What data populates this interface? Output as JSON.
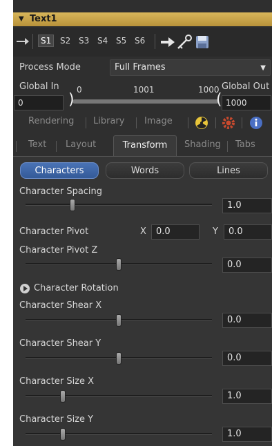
{
  "tool": {
    "name": "Text1"
  },
  "toolbar": {
    "slots": [
      "S1",
      "S2",
      "S3",
      "S4",
      "S5",
      "S6"
    ],
    "selected_slot": "S1"
  },
  "process_mode": {
    "label": "Process Mode",
    "value": "Full Frames"
  },
  "range": {
    "global_in_label": "Global In",
    "global_out_label": "Global Out",
    "in_tick": "0",
    "mid_tick": "1001",
    "out_tick": "1000",
    "global_in_value": "0",
    "global_out_value": "1000"
  },
  "tabs_row1": [
    "Rendering",
    "Library",
    "Image"
  ],
  "tabs_row2": [
    "Text",
    "Layout",
    "Transform",
    "Shading",
    "Tabs"
  ],
  "active_tab": "Transform",
  "segments": {
    "characters": "Characters",
    "words": "Words",
    "lines": "Lines",
    "active": "Characters"
  },
  "params": {
    "char_spacing": {
      "label": "Character Spacing",
      "value": "1.0",
      "level": 0.25
    },
    "char_pivot": {
      "label": "Character Pivot",
      "x_label": "X",
      "x_value": "0.0",
      "y_label": "Y",
      "y_value": "0.0"
    },
    "char_pivot_z": {
      "label": "Character Pivot Z",
      "value": "0.0",
      "level": 0.5
    },
    "char_rotation": {
      "label": "Character Rotation"
    },
    "char_shear_x": {
      "label": "Character Shear X",
      "value": "0.0",
      "level": 0.5
    },
    "char_shear_y": {
      "label": "Character Shear Y",
      "value": "0.0",
      "level": 0.5
    },
    "char_size_x": {
      "label": "Character Size X",
      "value": "1.0",
      "level": 0.2
    },
    "char_size_y": {
      "label": "Character Size Y",
      "value": "1.0",
      "level": 0.2
    }
  }
}
